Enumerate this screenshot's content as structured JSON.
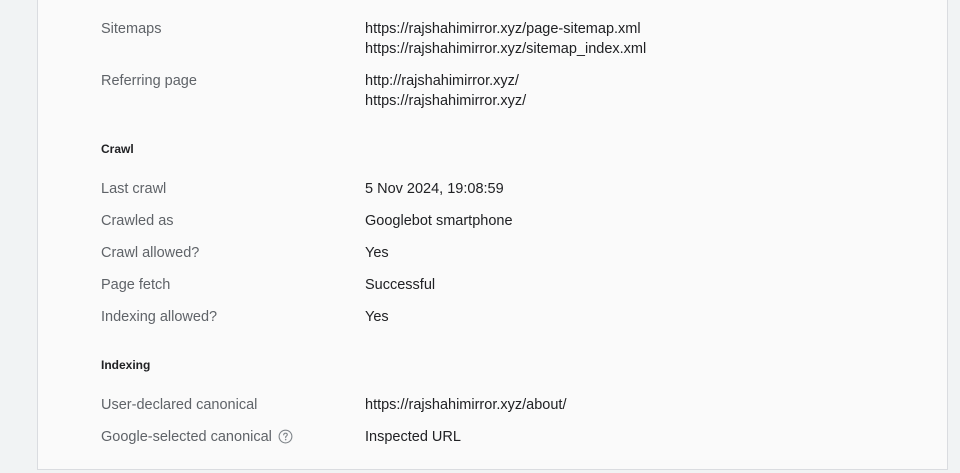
{
  "sitemaps": {
    "label": "Sitemaps",
    "values": [
      "https://rajshahimirror.xyz/page-sitemap.xml",
      "https://rajshahimirror.xyz/sitemap_index.xml"
    ]
  },
  "referring": {
    "label": "Referring page",
    "values": [
      "http://rajshahimirror.xyz/",
      "https://rajshahimirror.xyz/"
    ]
  },
  "crawl": {
    "title": "Crawl",
    "rows": [
      {
        "label": "Last crawl",
        "value": "5 Nov 2024, 19:08:59"
      },
      {
        "label": "Crawled as",
        "value": "Googlebot smartphone"
      },
      {
        "label": "Crawl allowed?",
        "value": "Yes"
      },
      {
        "label": "Page fetch",
        "value": "Successful"
      },
      {
        "label": "Indexing allowed?",
        "value": "Yes"
      }
    ]
  },
  "indexing": {
    "title": "Indexing",
    "rows": [
      {
        "label": "User-declared canonical",
        "value": "https://rajshahimirror.xyz/about/"
      },
      {
        "label": "Google-selected canonical",
        "value": "Inspected URL",
        "icon": "help-icon"
      }
    ]
  }
}
